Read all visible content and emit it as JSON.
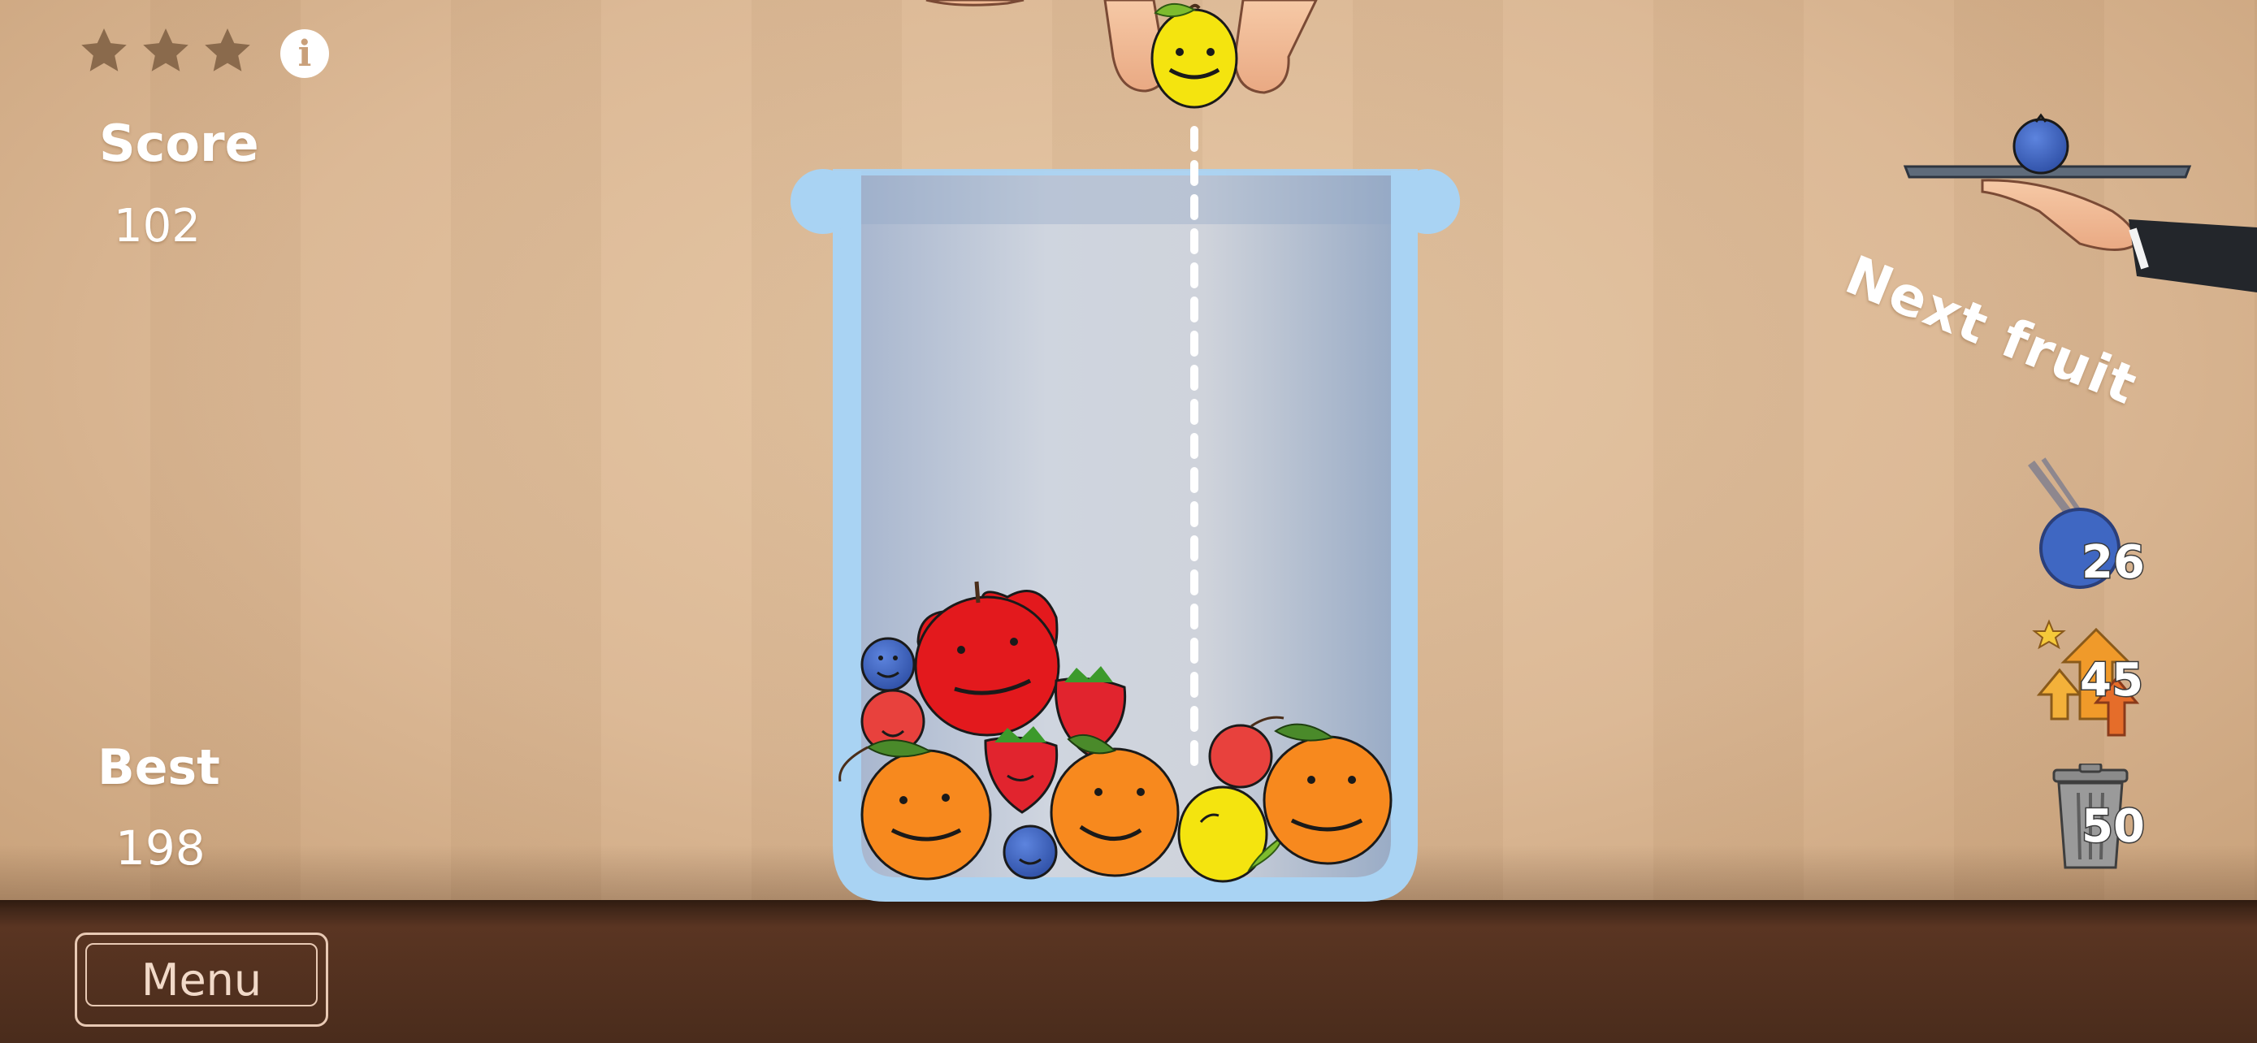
{
  "hud": {
    "stars_filled": 0,
    "stars_total": 3,
    "info_icon": "i",
    "score_label": "Score",
    "score_value": "102",
    "best_label": "Best",
    "best_value": "198"
  },
  "next_fruit": {
    "label": "Next fruit",
    "fruit": "blueberry"
  },
  "current_fruit": "lemon",
  "powerups": [
    {
      "name": "blueberry-drop",
      "count": "26"
    },
    {
      "name": "upgrade-arrows",
      "count": "45"
    },
    {
      "name": "trash-can",
      "count": "50"
    }
  ],
  "menu": {
    "label": "Menu"
  },
  "colors": {
    "glass": "#a9d3f3",
    "apple": "#e3191d",
    "orange": "#f7891e",
    "lemon": "#f4e40f",
    "blueberry": "#3f67c2",
    "cherry": "#e8413d",
    "strawberry": "#e1242e"
  }
}
